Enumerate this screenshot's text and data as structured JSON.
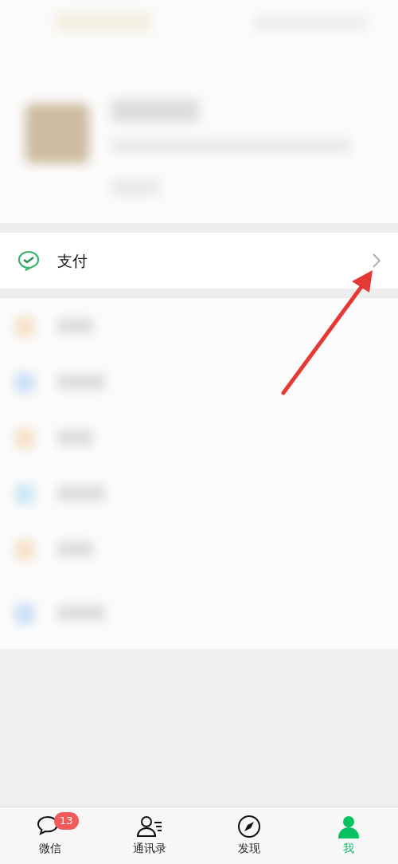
{
  "pay_row": {
    "label": "支付"
  },
  "tabs": [
    {
      "label": "微信",
      "kind": "chats",
      "selected": false,
      "badge": "13"
    },
    {
      "label": "通讯录",
      "kind": "contacts",
      "selected": false
    },
    {
      "label": "发现",
      "kind": "discover",
      "selected": false
    },
    {
      "label": "我",
      "kind": "me",
      "selected": true
    }
  ]
}
